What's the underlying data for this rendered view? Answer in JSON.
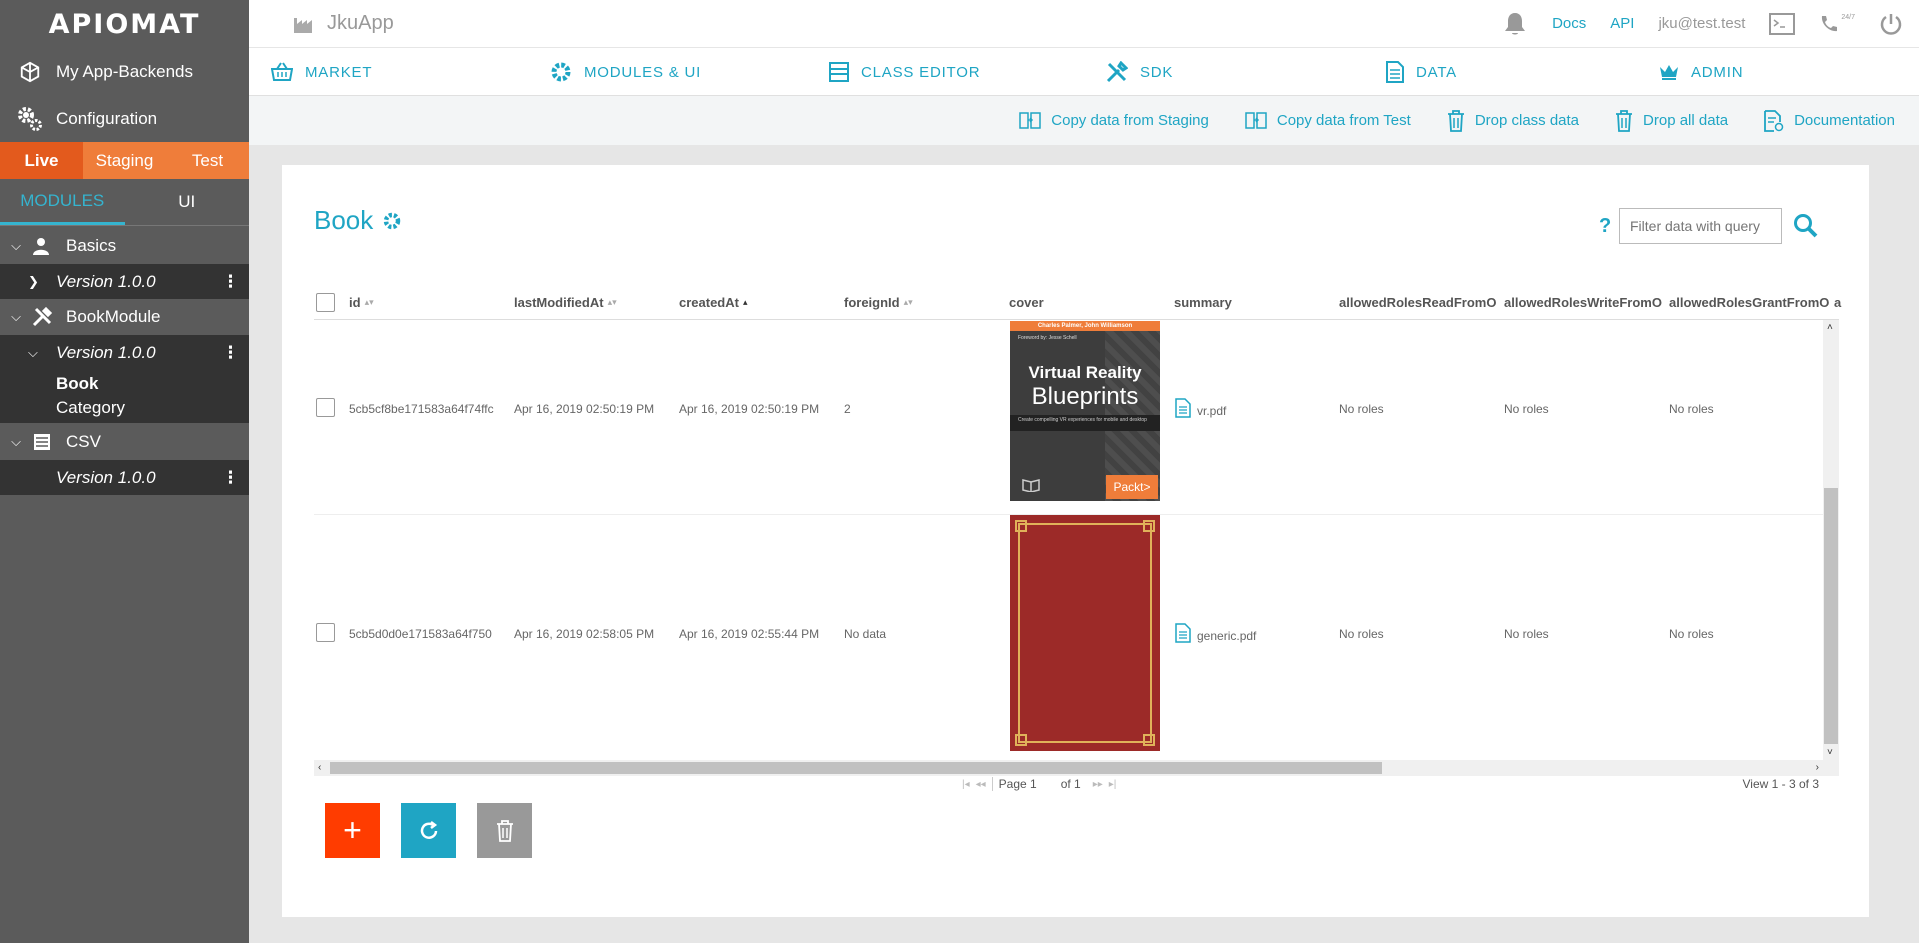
{
  "brand": {
    "logo_text": "APIOMAT"
  },
  "sidebar": {
    "nav": [
      {
        "label": "My App-Backends",
        "icon": "cube-icon"
      },
      {
        "label": "Configuration",
        "icon": "gears-icon"
      }
    ],
    "env_tabs": [
      "Live",
      "Staging",
      "Test"
    ],
    "active_env": "Live",
    "module_tabs": [
      "MODULES",
      "UI"
    ],
    "active_module_tab": "MODULES",
    "modules": [
      {
        "name": "Basics",
        "version": "Version 1.0.0",
        "classes": []
      },
      {
        "name": "BookModule",
        "version": "Version 1.0.0",
        "classes": [
          "Book",
          "Category"
        ]
      },
      {
        "name": "CSV",
        "version": "Version 1.0.0",
        "classes": []
      }
    ]
  },
  "topbar": {
    "app_name": "JkuApp",
    "docs": "Docs",
    "api": "API",
    "user": "jku@test.test",
    "support_badge": "24/7"
  },
  "mainnav": {
    "items": [
      "MARKET",
      "MODULES & UI",
      "CLASS EDITOR",
      "SDK",
      "DATA",
      "ADMIN"
    ]
  },
  "actions": {
    "items": [
      "Copy data from Staging",
      "Copy data from Test",
      "Drop class data",
      "Drop all data",
      "Documentation"
    ]
  },
  "page": {
    "title": "Book",
    "help": "?",
    "filter_placeholder": "Filter data with query"
  },
  "table": {
    "columns": [
      "id",
      "lastModifiedAt",
      "createdAt",
      "foreignId",
      "cover",
      "summary",
      "allowedRolesReadFromO",
      "allowedRolesWriteFromO",
      "allowedRolesGrantFromO",
      "a"
    ],
    "rows": [
      {
        "id": "5cb5cf8be171583a64f74ffc",
        "lastModifiedAt": "Apr 16, 2019 02:50:19 PM",
        "createdAt": "Apr 16, 2019 02:50:19 PM",
        "foreignId": "2",
        "cover": {
          "authors": "Charles Palmer, John Williamson",
          "foreword": "Foreword by: Jesse Schell",
          "title1": "Virtual Reality",
          "title2": "Blueprints",
          "subtitle": "Create compelling VR experiences for mobile and desktop",
          "publisher": "Packt>"
        },
        "summary": "vr.pdf",
        "read": "No roles",
        "write": "No roles",
        "grant": "No roles"
      },
      {
        "id": "5cb5d0d0e171583a64f750",
        "lastModifiedAt": "Apr 16, 2019 02:58:05 PM",
        "createdAt": "Apr 16, 2019 02:55:44 PM",
        "foreignId": "No data",
        "cover": null,
        "summary": "generic.pdf",
        "read": "No roles",
        "write": "No roles",
        "grant": "No roles"
      }
    ]
  },
  "pager": {
    "page_label": "Page 1",
    "of_label": "of 1",
    "view_count": "View 1 - 3 of 3"
  },
  "buttons": {
    "add": "+"
  },
  "colors": {
    "accent": "#1fa5c4",
    "orange": "#ef7d3a",
    "add": "#ff3c00",
    "sidebar": "#5b5b5b"
  }
}
